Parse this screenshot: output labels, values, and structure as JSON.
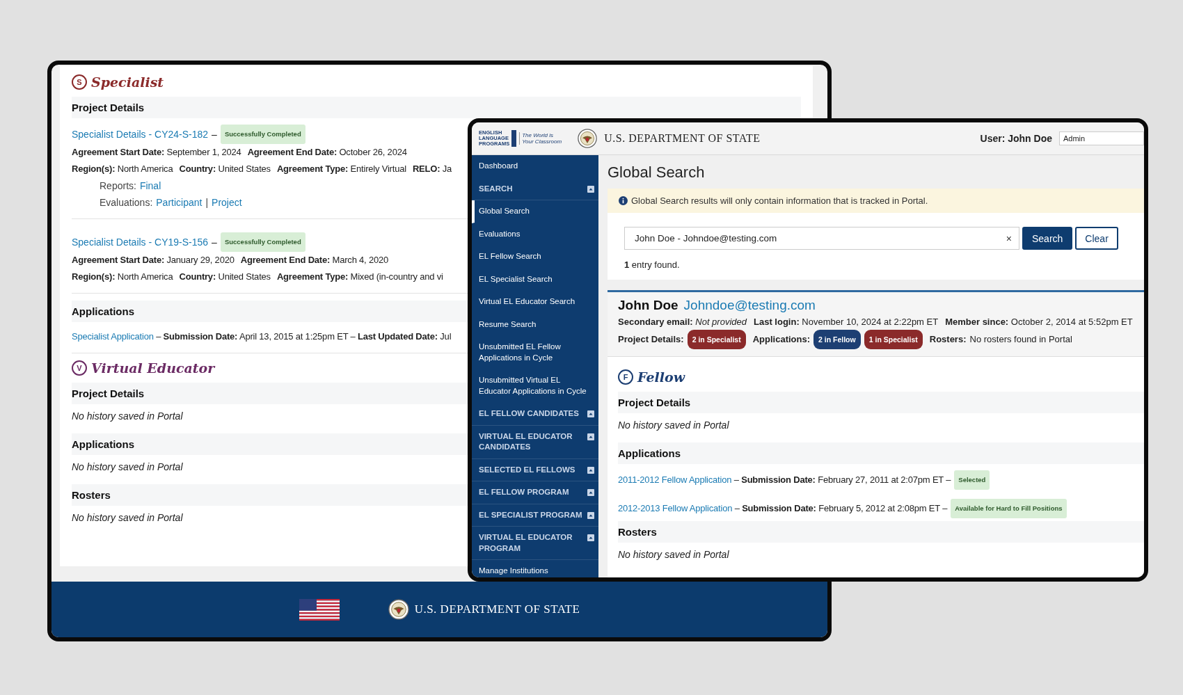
{
  "back_window": {
    "sections": [
      {
        "letter": "S",
        "title": "Specialist",
        "color": "#8b2a2a",
        "groups": [
          {
            "heading": "Project Details",
            "items": [
              {
                "kind": "project",
                "link": "Specialist Details - CY24-S-182",
                "separator": "–",
                "badge": "Successfully Completed",
                "rows": [
                  [
                    "**Agreement Start Date:** September 1, 2024",
                    "**Agreement End Date:** October 26, 2024"
                  ],
                  [
                    "**Region(s):** North America",
                    "**Country:** United States",
                    "**Agreement Type:** Entirely Virtual",
                    "**RELO:** Ja"
                  ]
                ],
                "link_groups": [
                  {
                    "label": "Reports:",
                    "links": [
                      "Final"
                    ]
                  },
                  {
                    "label": "Evaluations:",
                    "links": [
                      "Participant",
                      "Project"
                    ],
                    "separator": "|"
                  }
                ]
              },
              {
                "kind": "project",
                "link": "Specialist Details - CY19-S-156",
                "separator": "–",
                "badge": "Successfully Completed",
                "rows": [
                  [
                    "**Agreement Start Date:** January 29, 2020",
                    "**Agreement End Date:** March 4, 2020"
                  ],
                  [
                    "**Region(s):** North America",
                    "**Country:** United States",
                    "**Agreement Type:** Mixed (in-country and vi"
                  ]
                ]
              }
            ]
          },
          {
            "heading": "Applications",
            "items": [
              {
                "kind": "application",
                "link": "Specialist Application",
                "text": "– **Submission Date:** April 13, 2015 at 1:25pm ET – **Last Updated Date:** Jul"
              }
            ]
          }
        ]
      },
      {
        "letter": "V",
        "title": "Virtual Educator",
        "color": "#6b2b64",
        "groups": [
          {
            "heading": "Project Details",
            "items": [
              {
                "kind": "empty",
                "text": "No history saved in Portal"
              }
            ]
          },
          {
            "heading": "Applications",
            "items": [
              {
                "kind": "empty",
                "text": "No history saved in Portal"
              }
            ]
          },
          {
            "heading": "Rosters",
            "items": [
              {
                "kind": "empty",
                "text": "No history saved in Portal"
              }
            ]
          }
        ]
      }
    ],
    "footer": {
      "agency": "U.S. DEPARTMENT OF STATE"
    }
  },
  "front_window": {
    "header": {
      "logo_lines": [
        "ENGLISH",
        "LANGUAGE",
        "PROGRAMS"
      ],
      "tagline": "The World is Your Classroom",
      "agency": "U.S. DEPARTMENT OF STATE",
      "user_label": "User: John Doe",
      "role": "Admin"
    },
    "sidebar": [
      {
        "kind": "link",
        "label": "Dashboard",
        "selected": false
      },
      {
        "kind": "group",
        "label": "SEARCH",
        "selected": false
      },
      {
        "kind": "link",
        "label": "Global Search",
        "selected": true
      },
      {
        "kind": "link",
        "label": "Evaluations",
        "selected": false
      },
      {
        "kind": "link",
        "label": "EL Fellow Search",
        "selected": false
      },
      {
        "kind": "link",
        "label": "EL Specialist Search",
        "selected": false
      },
      {
        "kind": "link",
        "label": "Virtual EL Educator Search",
        "selected": false
      },
      {
        "kind": "link",
        "label": "Resume Search",
        "selected": false
      },
      {
        "kind": "link",
        "label": "Unsubmitted EL Fellow Applications in Cycle",
        "selected": false
      },
      {
        "kind": "link",
        "label": "Unsubmitted Virtual EL Educator Applications in Cycle",
        "selected": false
      },
      {
        "kind": "group",
        "label": "EL FELLOW CANDIDATES",
        "selected": false
      },
      {
        "kind": "group",
        "label": "VIRTUAL EL EDUCATOR CANDIDATES",
        "selected": false
      },
      {
        "kind": "group",
        "label": "SELECTED EL FELLOWS",
        "selected": false
      },
      {
        "kind": "group",
        "label": "EL FELLOW PROGRAM",
        "selected": false
      },
      {
        "kind": "group",
        "label": "EL SPECIALIST PROGRAM",
        "selected": false
      },
      {
        "kind": "group",
        "label": "VIRTUAL EL EDUCATOR PROGRAM",
        "selected": false
      },
      {
        "kind": "link",
        "label": "Manage Institutions",
        "selected": false
      }
    ],
    "page_title": "Global Search",
    "notice": "Global Search results will only contain information that is tracked in Portal.",
    "search": {
      "value": "John Doe - Johndoe@testing.com",
      "clear_glyph": "×",
      "buttons": [
        {
          "label": "Search",
          "kind": "primary"
        },
        {
          "label": "Clear",
          "kind": "outline"
        }
      ]
    },
    "result_count": "**1** entry found.",
    "result": {
      "name": "John Doe",
      "email": "Johndoe@testing.com",
      "meta": [
        "**Secondary email:** *Not provided*",
        "**Last login:** November 10, 2024 at 2:22pm ET",
        "**Member since:** October 2, 2014 at 5:52pm ET"
      ],
      "summary": [
        {
          "label": "Project Details:",
          "badges": [
            {
              "text": "2 in Specialist",
              "color": "#8b2a2a"
            }
          ]
        },
        {
          "label": "Applications:",
          "badges": [
            {
              "text": "2 in Fellow",
              "color": "#1d3f73"
            },
            {
              "text": "1 in Specialist",
              "color": "#8b2a2a"
            }
          ]
        },
        {
          "label": "Rosters:",
          "text": "No rosters found in Portal"
        }
      ]
    },
    "sections": [
      {
        "letter": "F",
        "title": "Fellow",
        "color": "#1d3f73",
        "groups": [
          {
            "heading": "Project Details",
            "items": [
              {
                "kind": "empty",
                "text": "No history saved in Portal"
              }
            ]
          },
          {
            "heading": "Applications",
            "items": [
              {
                "kind": "application",
                "link": "2011-2012 Fellow Application",
                "text": "– **Submission Date:** February 27, 2011 at 2:07pm ET –",
                "badge": "Selected"
              },
              {
                "kind": "application",
                "link": "2012-2013 Fellow Application",
                "text": "– **Submission Date:** February 5, 2012 at 2:08pm ET –",
                "badge": "Available for Hard to Fill Positions"
              }
            ]
          },
          {
            "heading": "Rosters",
            "items": [
              {
                "kind": "empty",
                "text": "No history saved in Portal"
              }
            ]
          }
        ]
      }
    ]
  }
}
